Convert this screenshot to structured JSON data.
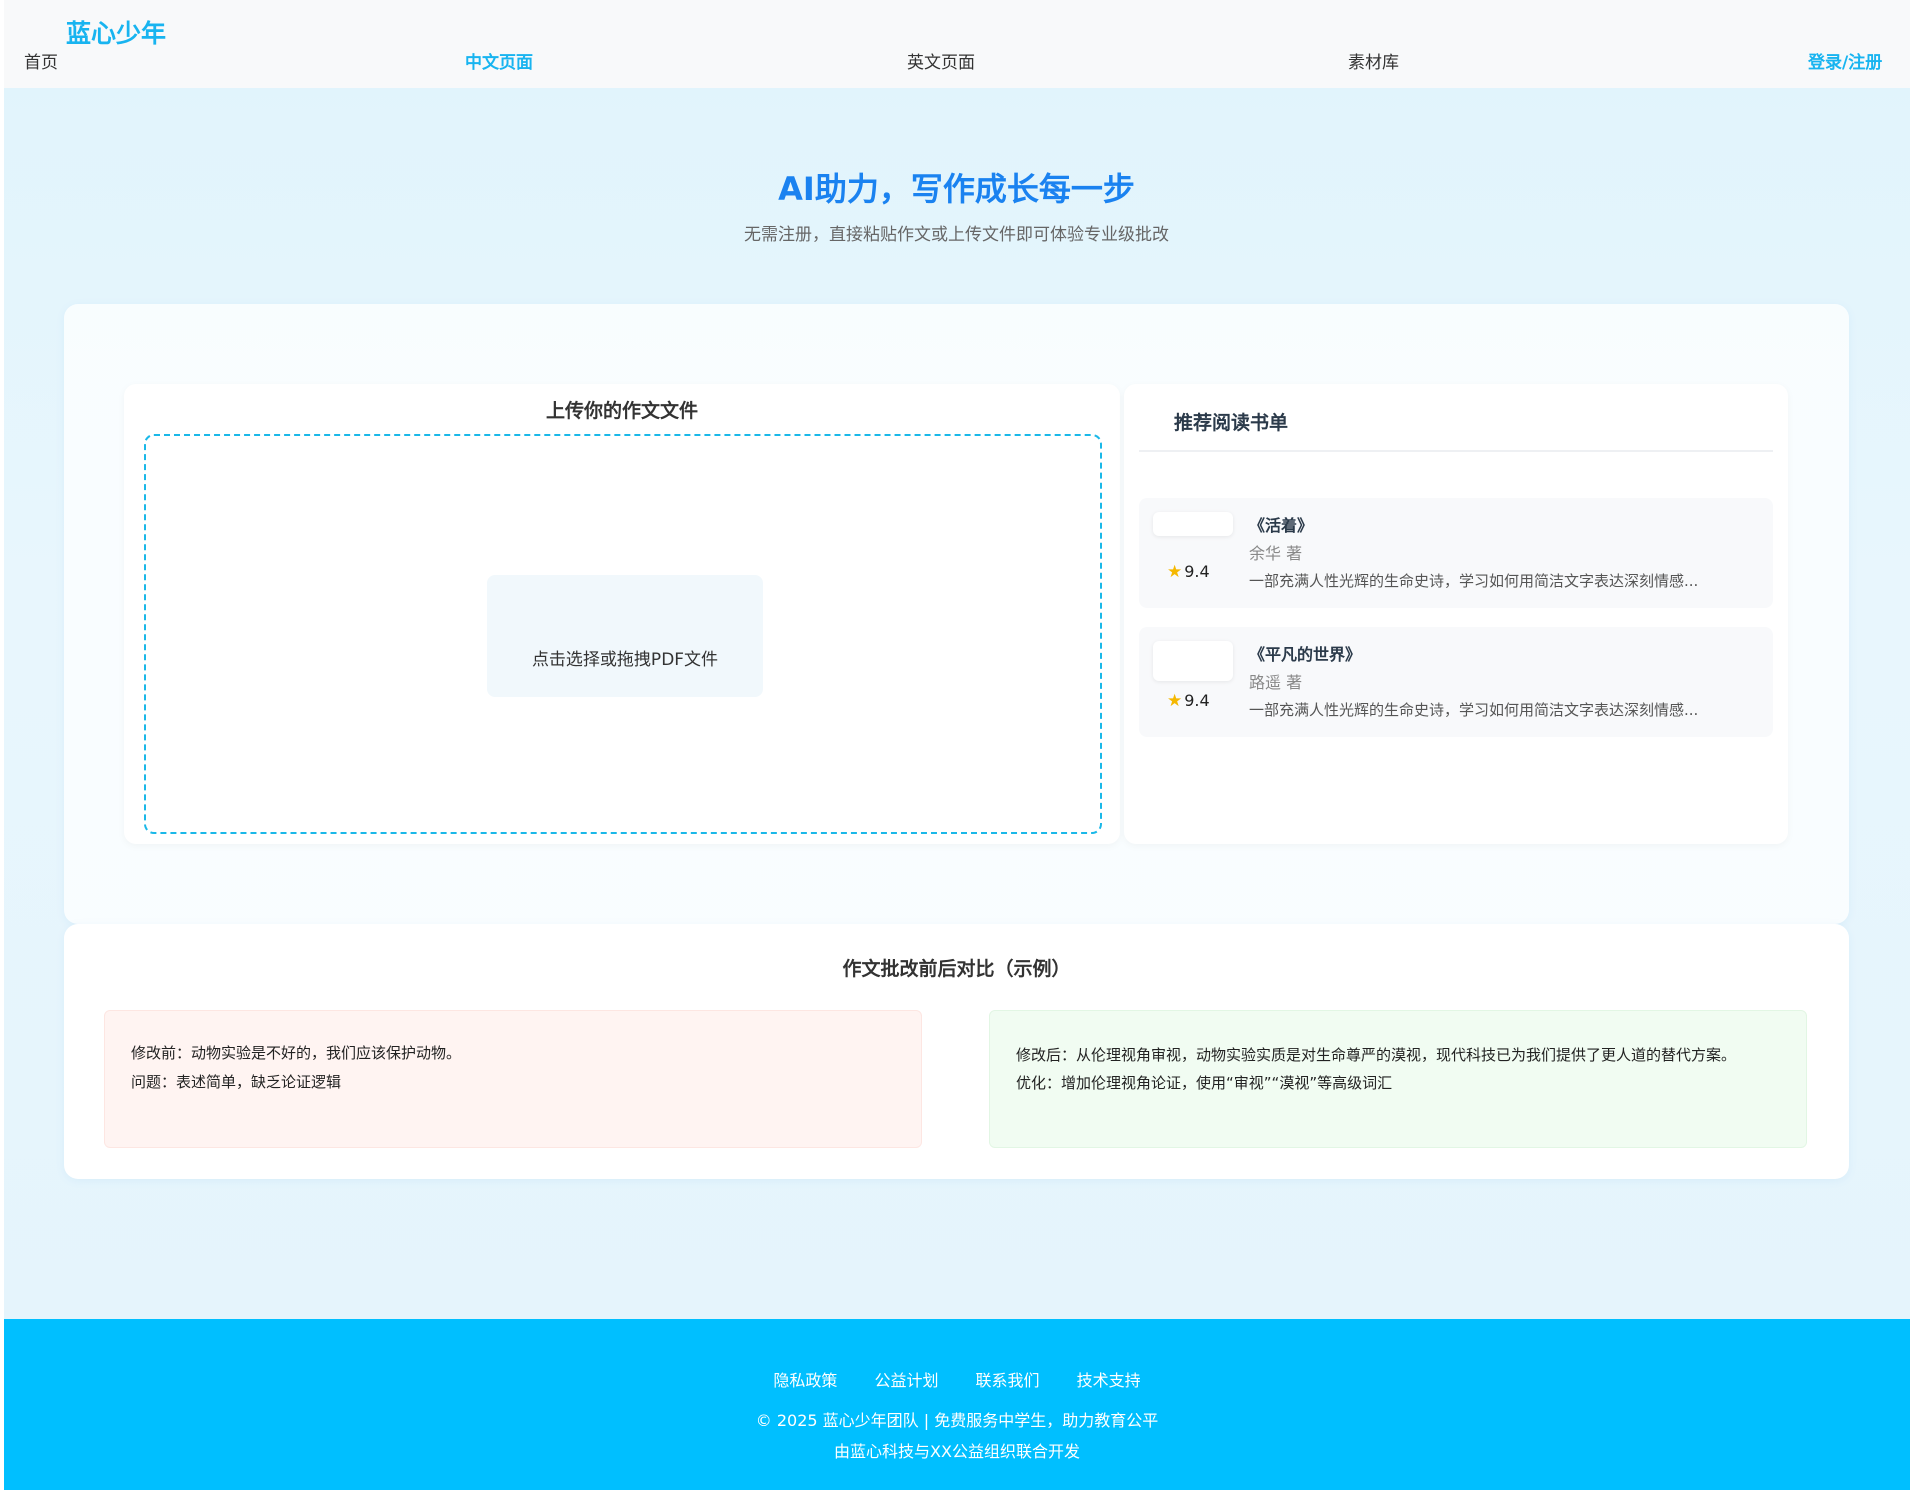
{
  "nav": {
    "logo": "蓝心少年",
    "links": [
      "首页",
      "中文页面",
      "英文页面",
      "素材库"
    ],
    "active_index": 1,
    "login": "登录/注册"
  },
  "hero": {
    "title": "AI助力，写作成长每一步",
    "subtitle": "无需注册，直接粘贴作文或上传文件即可体验专业级批改"
  },
  "upload": {
    "title": "上传你的作文文件",
    "button_label": "点击选择或拖拽PDF文件"
  },
  "books": {
    "title": "推荐阅读书单",
    "items": [
      {
        "name": "《活着》",
        "author": "余华 著",
        "rating": "9.4",
        "desc": "一部充满人性光辉的生命史诗，学习如何用简洁文字表达深刻情感..."
      },
      {
        "name": "《平凡的世界》",
        "author": "路遥 著",
        "rating": "9.4",
        "desc": "一部充满人性光辉的生命史诗，学习如何用简洁文字表达深刻情感..."
      }
    ]
  },
  "compare": {
    "title": "作文批改前后对比（示例）",
    "before": {
      "line1": "修改前：动物实验是不好的，我们应该保护动物。",
      "line2": "问题：表述简单，缺乏论证逻辑"
    },
    "after": {
      "line1": "修改后：从伦理视角审视，动物实验实质是对生命尊严的漠视，现代科技已为我们提供了更人道的替代方案。",
      "line2": "优化：增加伦理视角论证，使用“审视”“漠视”等高级词汇"
    }
  },
  "footer": {
    "links": [
      "隐私政策",
      "公益计划",
      "联系我们",
      "技术支持"
    ],
    "copyright": "© 2025 蓝心少年团队 | 免费服务中学生，助力教育公平",
    "developer": "由蓝心科技与XX公益组织联合开发"
  },
  "colors": {
    "brand": "#18b4f0",
    "hero_title": "#1a82f0",
    "footer_bg": "#00bfff",
    "before_bg": "#fff4f2",
    "after_bg": "#f1fcf2"
  }
}
